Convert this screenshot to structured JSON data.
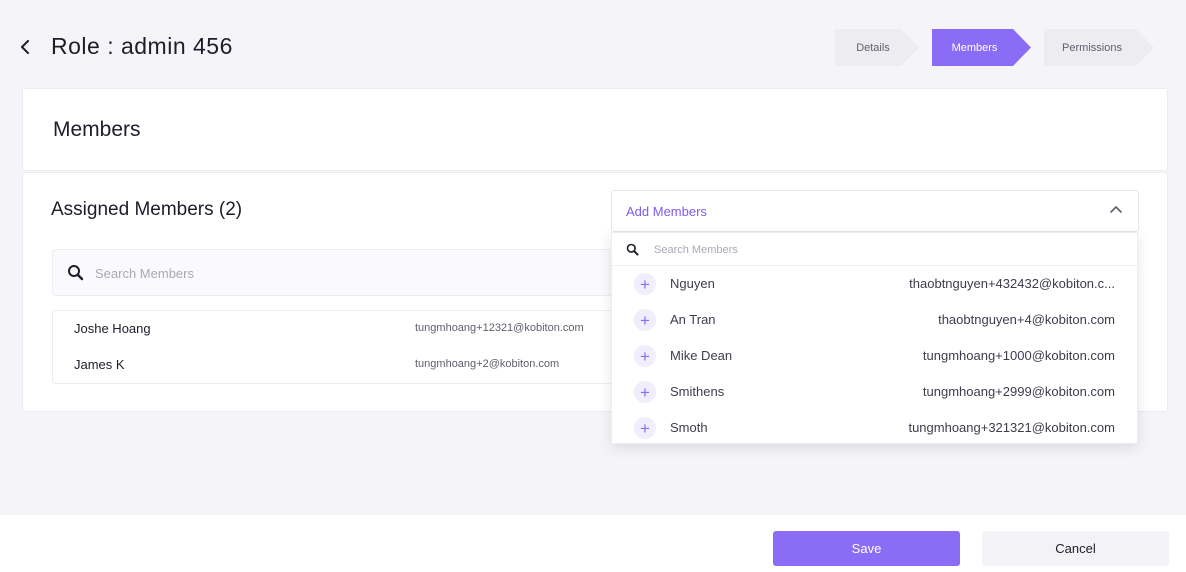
{
  "header": {
    "title": "Role : admin 456",
    "back_icon": "chevron-left-icon"
  },
  "stepper": {
    "steps": [
      {
        "label": "Details",
        "state": "inactive"
      },
      {
        "label": "Members",
        "state": "active"
      },
      {
        "label": "Permissions",
        "state": "inactive"
      }
    ]
  },
  "section": {
    "title": "Members"
  },
  "assigned": {
    "title": "Assigned Members (2)",
    "search_placeholder": "Search Members",
    "members": [
      {
        "name": "Joshe Hoang",
        "email": "tungmhoang+12321@kobiton.com"
      },
      {
        "name": "James K",
        "email": "tungmhoang+2@kobiton.com"
      }
    ]
  },
  "add_members": {
    "label": "Add Members",
    "search_placeholder": "Search Members",
    "options": [
      {
        "name": "Nguyen",
        "email": "thaobtnguyen+432432@kobiton.c..."
      },
      {
        "name": "An Tran",
        "email": "thaobtnguyen+4@kobiton.com"
      },
      {
        "name": "Mike Dean",
        "email": "tungmhoang+1000@kobiton.com"
      },
      {
        "name": "Smithens",
        "email": "tungmhoang+2999@kobiton.com"
      },
      {
        "name": "Smoth",
        "email": "tungmhoang+321321@kobiton.com"
      }
    ]
  },
  "footer": {
    "save_label": "Save",
    "cancel_label": "Cancel"
  },
  "colors": {
    "accent": "#8b6cf6",
    "background": "#f5f5f9"
  }
}
